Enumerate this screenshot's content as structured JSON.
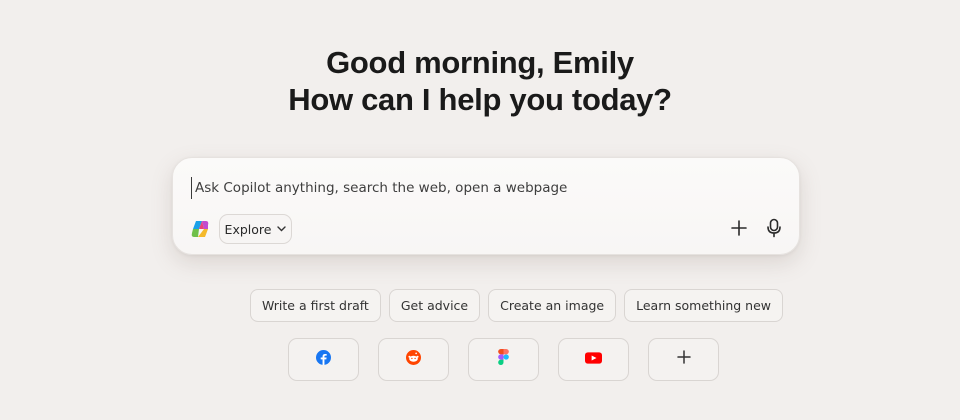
{
  "greeting": {
    "line1": "Good morning, Emily",
    "line2": "How can I help you today?"
  },
  "composer": {
    "placeholder": "Ask Copilot anything, search the web, open a webpage",
    "mode_label": "Explore"
  },
  "suggestions": [
    {
      "label": "Write a first draft"
    },
    {
      "label": "Get advice"
    },
    {
      "label": "Create an image"
    },
    {
      "label": "Learn something new"
    }
  ],
  "shortcuts": [
    {
      "icon": "facebook-icon",
      "color": "#1877f2"
    },
    {
      "icon": "reddit-icon",
      "color": "#ff4500"
    },
    {
      "icon": "figma-icon"
    },
    {
      "icon": "youtube-icon",
      "color": "#ff0000"
    },
    {
      "icon": "add-shortcut-icon"
    }
  ],
  "colors": {
    "background": "#f2efed",
    "text": "#1a1a1a"
  }
}
